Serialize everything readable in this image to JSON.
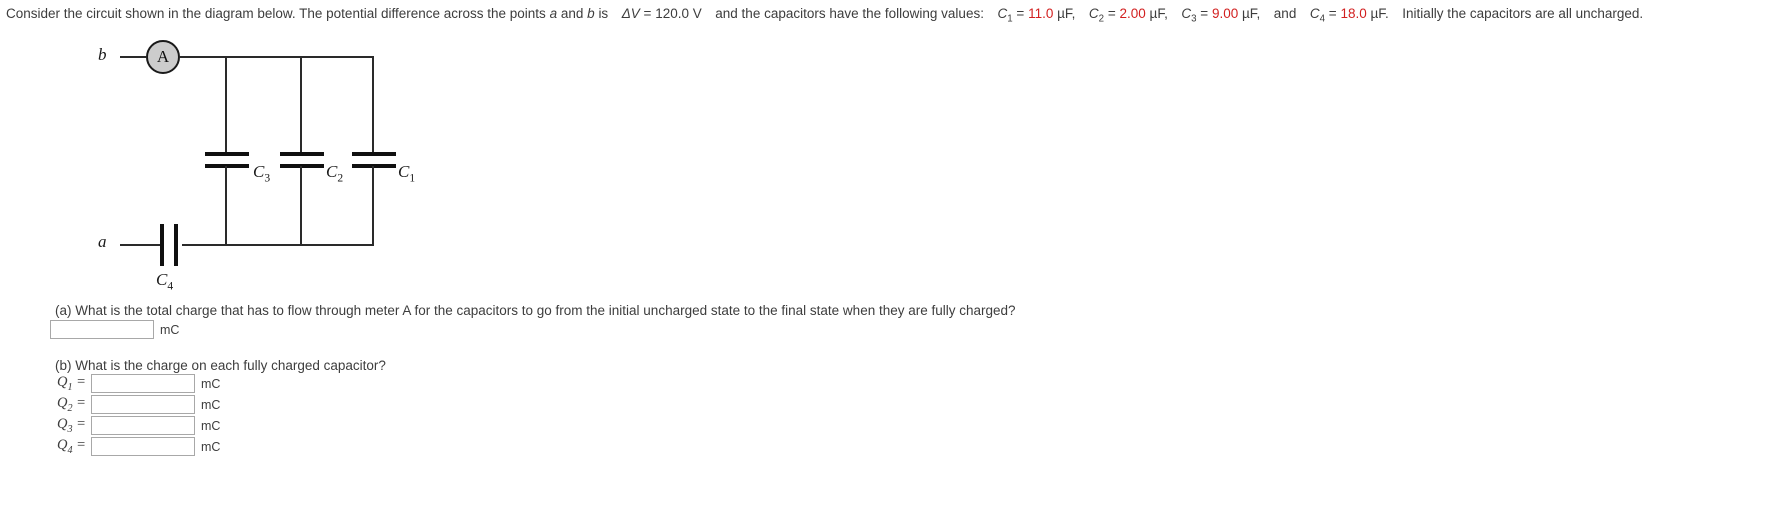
{
  "statement": {
    "part1": "Consider the circuit shown in the diagram below. The potential difference across the points",
    "point_a": "a",
    "and_1": "and",
    "point_b": "b",
    "is_word": "is",
    "dv_symbol": "ΔV",
    "dv_eq": "=",
    "dv_value": "120.0 V",
    "part2": "and the capacitors have the following values:",
    "c1_symbol": "C",
    "c1_sub": "1",
    "c1_eq": "=",
    "c1_value": "11.0",
    "c1_unit": "µF,",
    "c2_symbol": "C",
    "c2_sub": "2",
    "c2_eq": "=",
    "c2_value": "2.00",
    "c2_unit": "µF,",
    "c3_symbol": "C",
    "c3_sub": "3",
    "c3_eq": "=",
    "c3_value": "9.00",
    "c3_unit": "µF,",
    "and_2": "and",
    "c4_symbol": "C",
    "c4_sub": "4",
    "c4_eq": "=",
    "c4_value": "18.0",
    "c4_unit": "µF.",
    "part3": "Initially the capacitors are all uncharged.",
    "value_color": "#d21f1f"
  },
  "circuit": {
    "node_b": "b",
    "node_a": "a",
    "ammeter_label": "A",
    "ammeter_fill": "#cccccc",
    "wire_color": "#2a2a2a",
    "capacitors": [
      {
        "name": "C",
        "sub": "3"
      },
      {
        "name": "C",
        "sub": "2"
      },
      {
        "name": "C",
        "sub": "1"
      },
      {
        "name": "C",
        "sub": "4"
      }
    ]
  },
  "questions": {
    "part_a_text": "(a) What is the total charge that has to flow through meter A for the capacitors to go from the initial uncharged state to the final state when they are fully charged?",
    "part_a_value": "",
    "part_a_unit": "mC",
    "part_b_text": "(b) What is the charge on each fully charged capacitor?",
    "rows": [
      {
        "label": "Q",
        "sub": "1",
        "eq": "=",
        "value": "",
        "unit": "mC"
      },
      {
        "label": "Q",
        "sub": "2",
        "eq": "=",
        "value": "",
        "unit": "mC"
      },
      {
        "label": "Q",
        "sub": "3",
        "eq": "=",
        "value": "",
        "unit": "mC"
      },
      {
        "label": "Q",
        "sub": "4",
        "eq": "=",
        "value": "",
        "unit": "mC"
      }
    ]
  }
}
